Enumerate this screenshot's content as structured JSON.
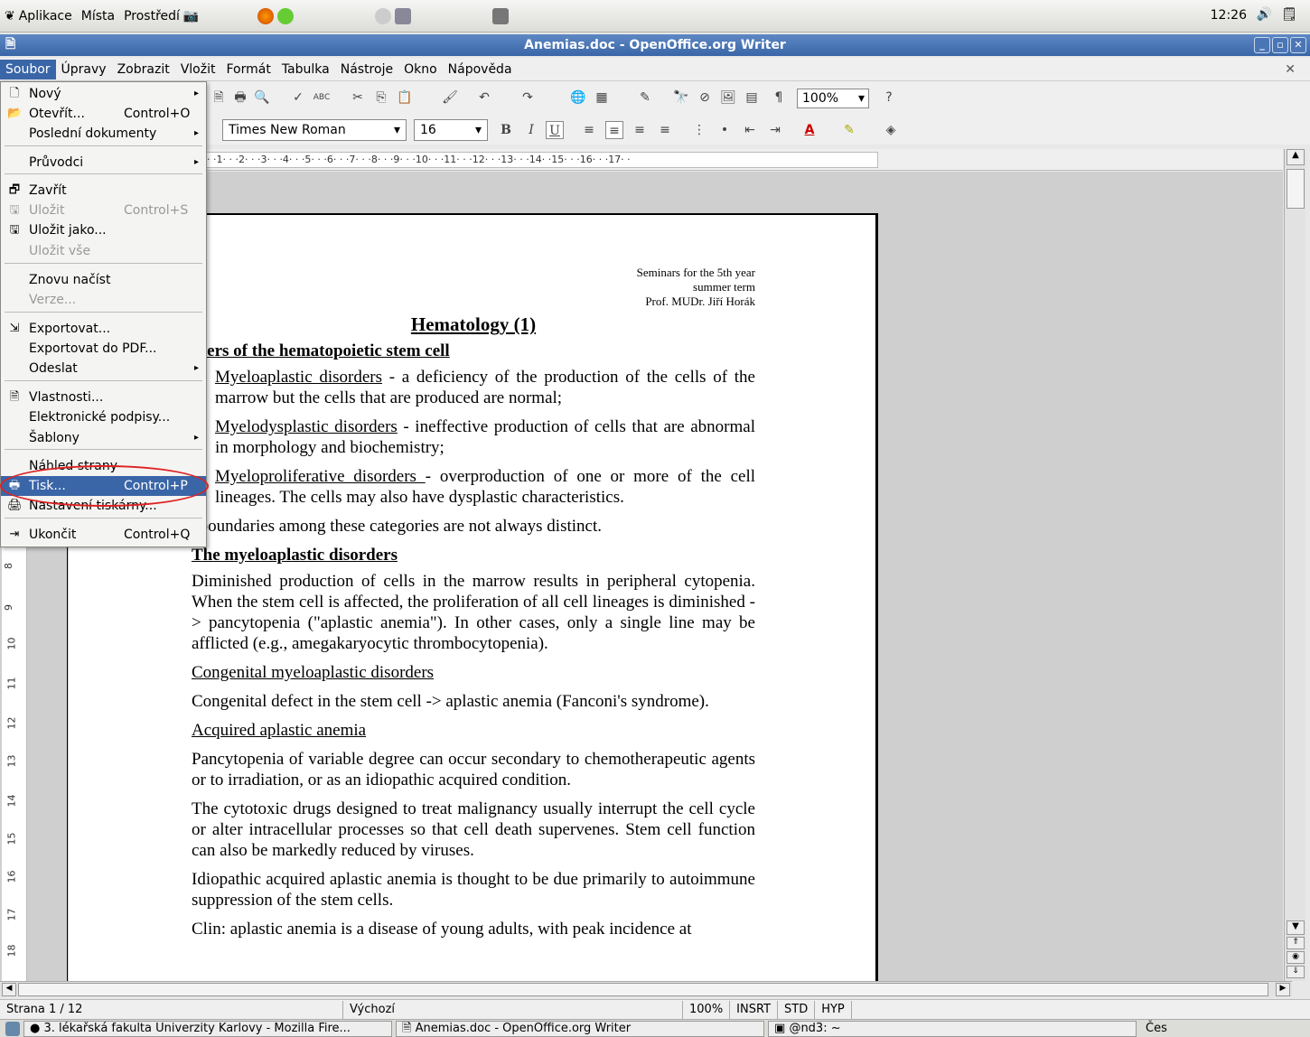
{
  "top_panel": {
    "apps": "Aplikace",
    "places": "Místa",
    "system": "Prostředí",
    "clock": "12:26"
  },
  "window": {
    "title": "Anemias.doc - OpenOffice.org Writer"
  },
  "menubar": {
    "items": [
      "Soubor",
      "Úpravy",
      "Zobrazit",
      "Vložit",
      "Formát",
      "Tabulka",
      "Nástroje",
      "Okno",
      "Nápověda"
    ]
  },
  "format_toolbar": {
    "font_name": "Times New Roman",
    "font_size": "16",
    "zoom": "100%"
  },
  "ruler": {
    "ticks": "· ·1· · ·2· · ·3· · ·4· · ·5· · ·6· · ·7· · ·8· · ·9· · ·10· · ·11· · ·12· · ·13· · ·14· ·15· · ·16· · ·17· ·"
  },
  "vruler": {
    "ticks": [
      "8",
      "9",
      "10",
      "11",
      "12",
      "13",
      "14",
      "15",
      "16",
      "17",
      "18"
    ]
  },
  "file_menu": {
    "items": [
      {
        "label": "Nový",
        "shortcut": "",
        "submenu": true,
        "icon": "new-doc-icon",
        "glyph": "🗋",
        "disabled": false
      },
      {
        "label": "Otevřít...",
        "shortcut": "Control+O",
        "submenu": false,
        "icon": "open-folder-icon",
        "glyph": "📂",
        "disabled": false
      },
      {
        "label": "Poslední dokumenty",
        "shortcut": "",
        "submenu": true,
        "icon": "",
        "glyph": "",
        "disabled": false
      },
      {
        "label": "Průvodci",
        "shortcut": "",
        "submenu": true,
        "icon": "",
        "glyph": "",
        "disabled": false
      },
      {
        "label": "Zavřít",
        "shortcut": "",
        "submenu": false,
        "icon": "close-doc-icon",
        "glyph": "🗗",
        "disabled": false
      },
      {
        "label": "Uložit",
        "shortcut": "Control+S",
        "submenu": false,
        "icon": "save-icon",
        "glyph": "🖫",
        "disabled": true
      },
      {
        "label": "Uložit jako...",
        "shortcut": "",
        "submenu": false,
        "icon": "save-as-icon",
        "glyph": "🖫",
        "disabled": false
      },
      {
        "label": "Uložit vše",
        "shortcut": "",
        "submenu": false,
        "icon": "",
        "glyph": "",
        "disabled": true
      },
      {
        "label": "Znovu načíst",
        "shortcut": "",
        "submenu": false,
        "icon": "",
        "glyph": "",
        "disabled": false
      },
      {
        "label": "Verze...",
        "shortcut": "",
        "submenu": false,
        "icon": "",
        "glyph": "",
        "disabled": true
      },
      {
        "label": "Exportovat...",
        "shortcut": "",
        "submenu": false,
        "icon": "export-icon",
        "glyph": "⇲",
        "disabled": false
      },
      {
        "label": "Exportovat do PDF...",
        "shortcut": "",
        "submenu": false,
        "icon": "",
        "glyph": "",
        "disabled": false
      },
      {
        "label": "Odeslat",
        "shortcut": "",
        "submenu": true,
        "icon": "",
        "glyph": "",
        "disabled": false
      },
      {
        "label": "Vlastnosti...",
        "shortcut": "",
        "submenu": false,
        "icon": "properties-icon",
        "glyph": "🗎",
        "disabled": false
      },
      {
        "label": "Elektronické podpisy...",
        "shortcut": "",
        "submenu": false,
        "icon": "",
        "glyph": "",
        "disabled": false
      },
      {
        "label": "Šablony",
        "shortcut": "",
        "submenu": true,
        "icon": "",
        "glyph": "",
        "disabled": false
      },
      {
        "label": "Náhled strany",
        "shortcut": "",
        "submenu": false,
        "icon": "",
        "glyph": "",
        "disabled": false
      },
      {
        "label": "Tisk...",
        "shortcut": "Control+P",
        "submenu": false,
        "icon": "print-icon",
        "glyph": "🖶",
        "disabled": false,
        "selected": true
      },
      {
        "label": "Nastavení tiskárny...",
        "shortcut": "",
        "submenu": false,
        "icon": "printer-settings-icon",
        "glyph": "🖨",
        "disabled": false
      },
      {
        "label": "Ukončit",
        "shortcut": "Control+Q",
        "submenu": false,
        "icon": "exit-icon",
        "glyph": "⇥",
        "disabled": false
      }
    ]
  },
  "document": {
    "header": [
      "Seminars for the 5th year",
      "summer term",
      "Prof. MUDr. Jiří Horák"
    ],
    "title": "Hematology (1)",
    "h_stem": "isorders of the hematopoietic stem cell",
    "p1_term": "Myeloaplastic disorders",
    "p1_rest": " - a deficiency of the production of the cells of the marrow but the cells that are produced are normal;",
    "p2_term": "Myelodysplastic disorders",
    "p2_rest": " - ineffective production of cells that are abnormal in morphology and biochemistry;",
    "p3_term": "Myeloproliferative disorders ",
    "p3_rest": "- overproduction of one or more of the cell lineages. The cells may also have dysplastic characteristics.",
    "p4": "he boundaries among these categories are not always distinct.",
    "h_myelo": "The myeloaplastic disorders",
    "p5": "Diminished production of cells in the marrow results in peripheral cytopenia. When the stem cell is affected, the proliferation of all cell lineages is diminished -> pancytopenia (\"aplastic anemia\"). In other cases, only a single line may be afflicted (e.g., amegakaryocytic thrombocytopenia).",
    "s_congenital": "Congenital myeloaplastic disorders",
    "p6": "Congenital defect in the stem cell -> aplastic anemia (Fanconi's syndrome).",
    "s_acquired": "Acquired aplastic anemia",
    "p7": "Pancytopenia of variable degree can occur secondary to chemotherapeutic agents or to irradiation, or as an idiopathic acquired condition.",
    "p8": "The cytotoxic drugs designed to treat malignancy usually interrupt the cell cycle or alter intracellular processes so that cell death supervenes. Stem cell function can also be markedly reduced by viruses.",
    "p9": "Idiopathic acquired aplastic anemia is thought to be due primarily to autoimmune suppression of the stem cells.",
    "p10": "Clin: aplastic anemia is a disease of young adults, with peak incidence at"
  },
  "statusbar": {
    "page": "Strana 1 / 12",
    "style": "Výchozí",
    "zoom": "100%",
    "insert": "INSRT",
    "std": "STD",
    "hyp": "HYP"
  },
  "taskbar": {
    "task1": "3. lékařská fakulta Univerzity Karlovy - Mozilla Fire...",
    "task2": "Anemias.doc - OpenOffice.org Writer",
    "task3": "@nd3: ~",
    "lang": "Čes"
  }
}
